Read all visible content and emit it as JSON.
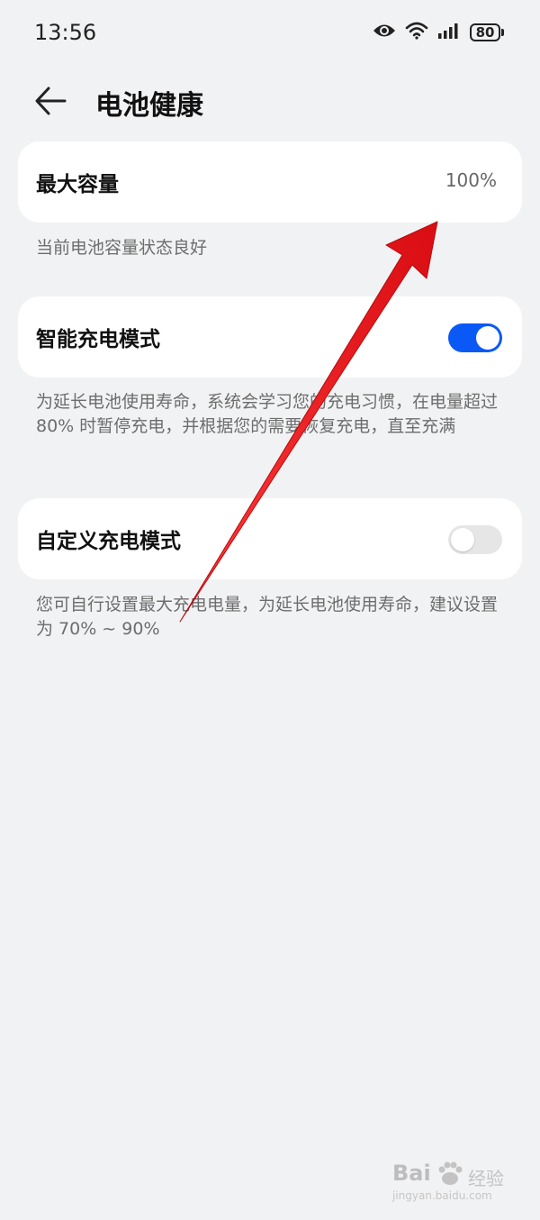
{
  "status_bar": {
    "time": "13:56",
    "icons": [
      "eye-icon",
      "wifi-icon",
      "signal-icon"
    ],
    "battery_level": "80"
  },
  "header": {
    "back_icon": "arrow-left-icon",
    "title": "电池健康"
  },
  "max_capacity": {
    "label": "最大容量",
    "value": "100%",
    "description": "当前电池容量状态良好"
  },
  "smart_charging": {
    "label": "智能充电模式",
    "enabled": true,
    "description": "为延长电池使用寿命，系统会学习您的充电习惯，在电量超过 80% 时暂停充电，并根据您的需要恢复充电，直至充满"
  },
  "custom_charging": {
    "label": "自定义充电模式",
    "enabled": false,
    "description": "您可自行设置最大充电电量，为延长电池使用寿命，建议设置为 70% ~ 90%"
  },
  "colors": {
    "accent": "#0a59f7",
    "background": "#f1f2f4",
    "annotation_arrow": "#e8141a"
  },
  "watermark": {
    "brand": "Bai",
    "brand_suffix": "经验",
    "url": "jingyan.baidu.com"
  }
}
